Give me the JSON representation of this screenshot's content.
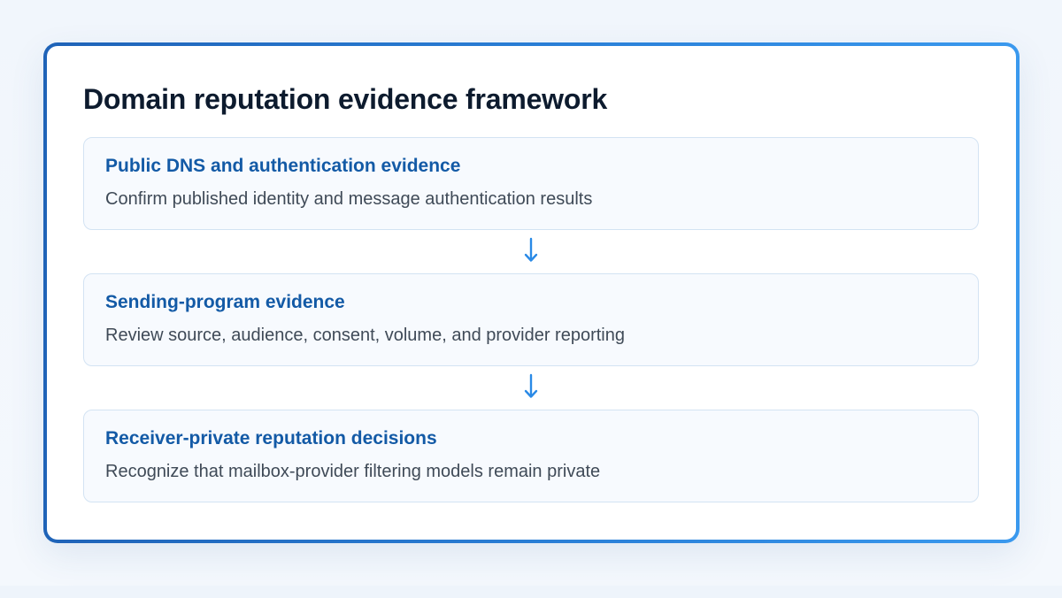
{
  "diagram": {
    "title": "Domain reputation evidence framework",
    "steps": [
      {
        "title": "Public DNS and authentication evidence",
        "description": "Confirm published identity and message authentication results"
      },
      {
        "title": "Sending-program evidence",
        "description": "Review source, audience, consent, volume, and provider reporting"
      },
      {
        "title": "Receiver-private reputation decisions",
        "description": "Recognize that mailbox-provider filtering models remain private"
      }
    ],
    "colors": {
      "frame_start": "#1f63b8",
      "frame_end": "#3a99ee",
      "heading": "#0d1b2e",
      "step_title": "#135aa6",
      "step_text": "#3f4a57",
      "step_border": "#d3e3f3",
      "step_fill": "#f7fafe",
      "arrow": "#2a8ae6"
    },
    "connector_icon": "arrow-down-icon"
  }
}
